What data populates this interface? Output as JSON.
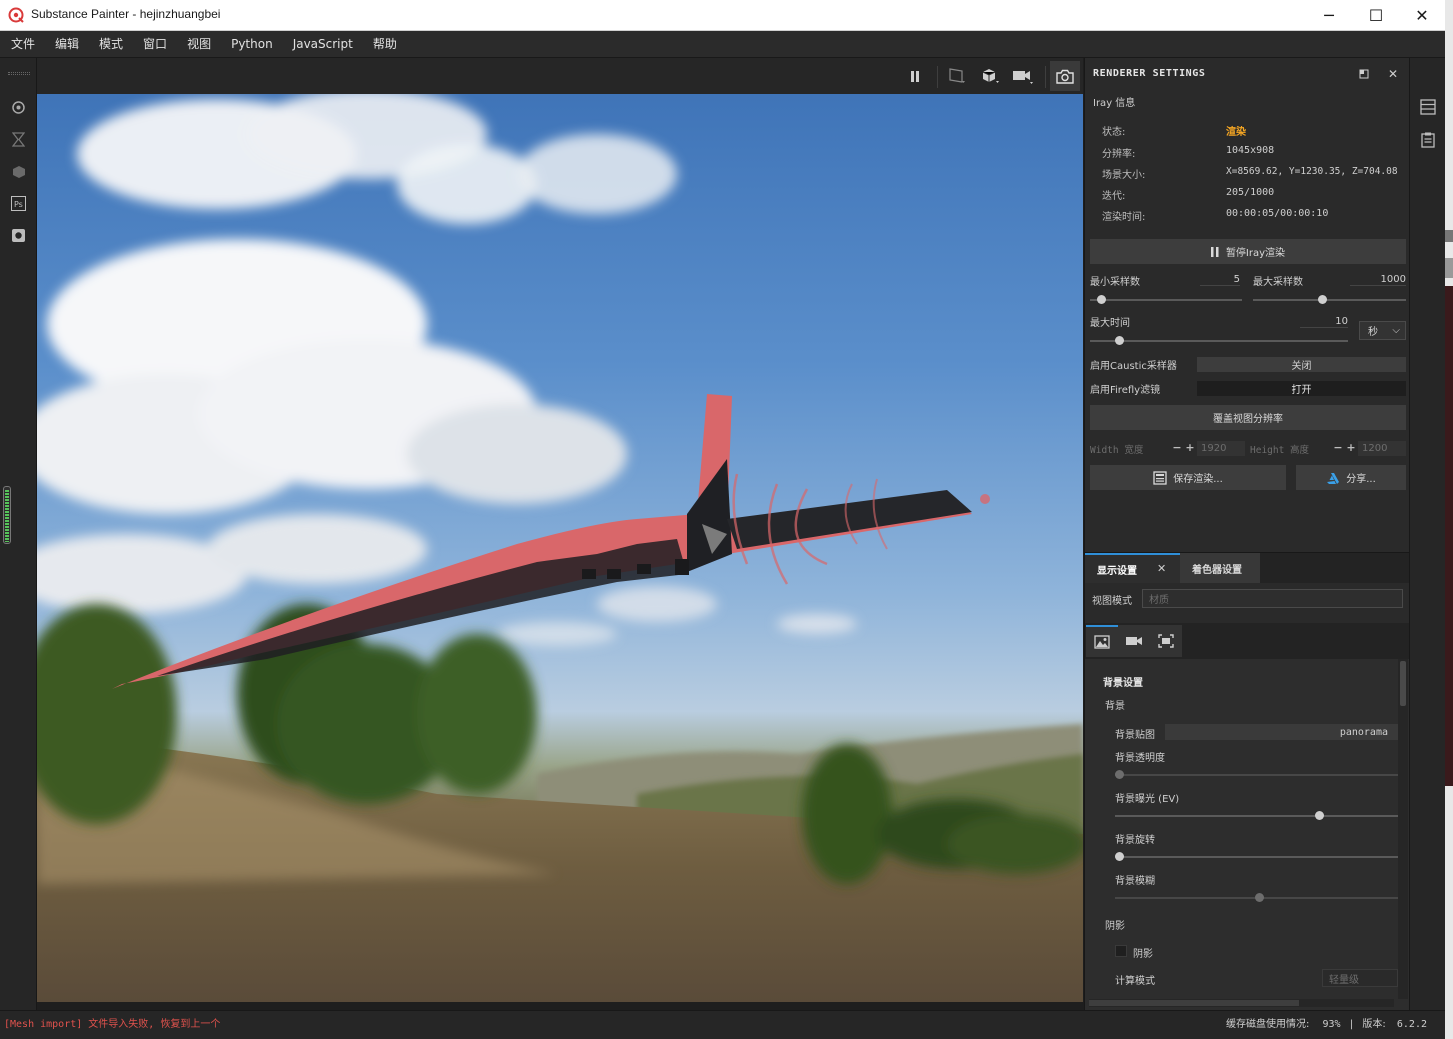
{
  "window": {
    "title": "Substance Painter - hejinzhuangbei",
    "minimize": "─",
    "maximize": "☐",
    "close": "✕"
  },
  "menu": [
    "文件",
    "编辑",
    "模式",
    "窗口",
    "视图",
    "Python",
    "JavaScript",
    "帮助"
  ],
  "left_toolbar_icons": [
    "layers-icon",
    "history-icon",
    "cube-icon",
    "photoshop-icon",
    "camera-icon"
  ],
  "renderer": {
    "title": "RENDERER SETTINGS",
    "section": "Iray 信息",
    "info": [
      {
        "key": "状态:",
        "value": "渲染",
        "accent": true
      },
      {
        "key": "分辨率:",
        "value": "1045x908"
      },
      {
        "key": "场景大小:",
        "value": "X=8569.62, Y=1230.35, Z=704.08"
      },
      {
        "key": "迭代:",
        "value": "205/1000"
      },
      {
        "key": "渲染时间:",
        "value": "00:00:05/00:00:10"
      }
    ],
    "pause_button": "暂停Iray渲染",
    "min_samples": {
      "label": "最小采样数",
      "value": "5",
      "fraction": 0.05
    },
    "max_samples": {
      "label": "最大采样数",
      "value": "1000",
      "fraction": 0.45
    },
    "max_time": {
      "label": "最大时间",
      "value": "10",
      "unit": "秒",
      "fraction": 0.1
    },
    "caustic": {
      "label": "启用Caustic采样器",
      "value": "关闭"
    },
    "firefly": {
      "label": "启用Firefly滤镜",
      "value": "打开"
    },
    "override_button": "覆盖视图分辨率",
    "width": {
      "label": "Width 宽度",
      "minus": "−",
      "plus": "+",
      "value": "1920"
    },
    "height": {
      "label": "Height 高度",
      "minus": "−",
      "plus": "+",
      "value": "1200"
    },
    "save_button": "保存渲染...",
    "share_button": "分享..."
  },
  "display": {
    "tab_display": "显示设置",
    "tab_close": "✕",
    "tab_shader": "着色器设置",
    "view_mode_label": "视图模式",
    "view_mode_placeholder": "材质",
    "section_title": "背景设置",
    "background_label": "背景",
    "bg_map_label": "背景贴图",
    "bg_map_value": "panorama",
    "bg_opacity_label": "背景透明度",
    "bg_opacity_fraction": 0.0,
    "bg_exposure_label": "背景曝光 (EV)",
    "bg_exposure_fraction": 0.73,
    "bg_rotation_label": "背景旋转",
    "bg_rotation_fraction": 0.0,
    "bg_blur_label": "背景模糊",
    "bg_blur_fraction": 0.51,
    "shadow_section": "阴影",
    "shadow_checkbox_label": "阴影",
    "compute_mode_label": "计算模式",
    "compute_mode_value": "轻量级"
  },
  "status": {
    "error": "[Mesh import] 文件导入失败, 恢复到上一个",
    "cache": "缓存磁盘使用情况:",
    "cache_value": "93%",
    "version_label": "版本:",
    "version": "6.2.2"
  }
}
